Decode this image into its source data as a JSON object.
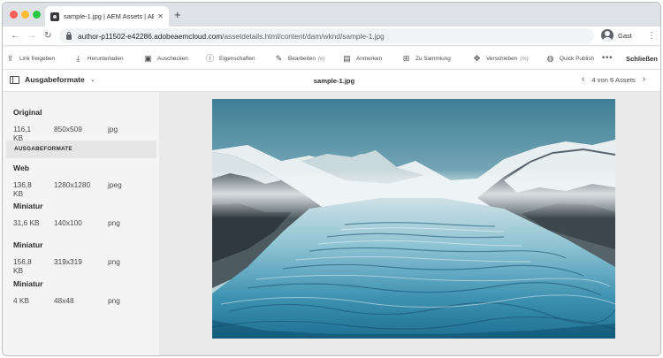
{
  "browser": {
    "tab_title": "sample-1.jpg | AEM Assets | AE",
    "tab_close": "✕",
    "new_tab": "+",
    "back": "←",
    "forward": "→",
    "reload": "↻",
    "url_host": "author-p11502-e42286.adobeaemcloud.com",
    "url_path": "/assetdetails.html/content/dam/wknd/sample-1.jpg",
    "profile_name": "Gast",
    "menu": "⋮"
  },
  "actionbar": {
    "items": [
      {
        "label": "Link freigeben",
        "icon": "share-icon",
        "glyph": "⇪",
        "shortcut": ""
      },
      {
        "label": "Herunterladen",
        "icon": "download-icon",
        "glyph": "⤓",
        "shortcut": ""
      },
      {
        "label": "Auschecken",
        "icon": "lock-icon",
        "glyph": "▣",
        "shortcut": ""
      },
      {
        "label": "Eigenschaften",
        "icon": "info-icon",
        "glyph": "ⓘ",
        "shortcut": ""
      },
      {
        "label": "Bearbeiten",
        "icon": "edit-icon",
        "glyph": "✎",
        "shortcut": "(e)"
      },
      {
        "label": "Anmerken",
        "icon": "annotate-icon",
        "glyph": "▤",
        "shortcut": ""
      },
      {
        "label": "Zu Sammlung",
        "icon": "collection-icon",
        "glyph": "⊞",
        "shortcut": ""
      },
      {
        "label": "Verschieben",
        "icon": "move-icon",
        "glyph": "✥",
        "shortcut": "(m)"
      },
      {
        "label": "Quick Publish",
        "icon": "globe-icon",
        "glyph": "◍",
        "shortcut": ""
      }
    ],
    "more": "•••",
    "close_label": "Schließen"
  },
  "asset_header": {
    "rail_label": "Ausgabeformate",
    "rail_chevron": "⌄",
    "title": "sample-1.jpg",
    "prev": "‹",
    "next": "›",
    "count": "4 von 6 Assets"
  },
  "renditions": {
    "original": {
      "title": "Original",
      "size": "116,1 KB",
      "dimensions": "850x509",
      "type": "jpg"
    },
    "section_heading": "AUSGABEFORMATE",
    "items": [
      {
        "title": "Web",
        "size": "136,8 KB",
        "dimensions": "1280x1280",
        "type": "jpeg"
      },
      {
        "title": "Miniatur",
        "size": "31,6 KB",
        "dimensions": "140x100",
        "type": "png"
      },
      {
        "title": "Miniatur",
        "size": "156,8 KB",
        "dimensions": "319x319",
        "type": "png"
      },
      {
        "title": "Miniatur",
        "size": "4 KB",
        "dimensions": "48x48",
        "type": "png"
      }
    ]
  }
}
